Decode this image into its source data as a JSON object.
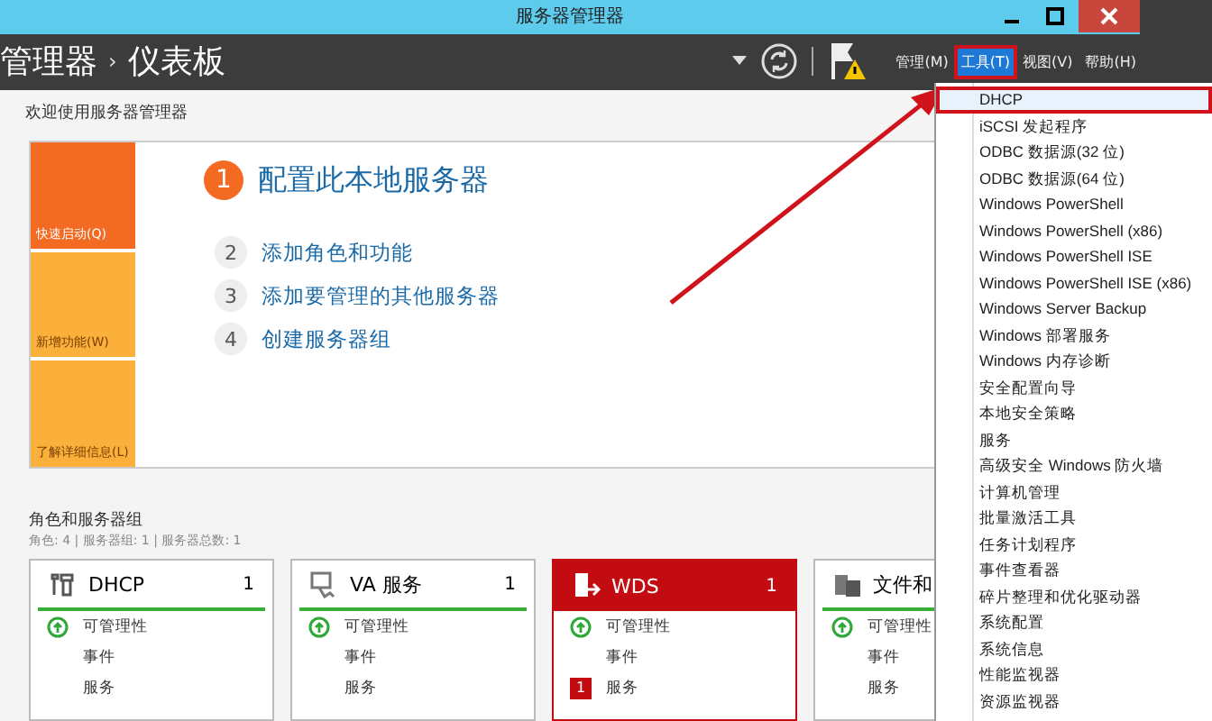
{
  "window": {
    "title": "服务器管理器"
  },
  "breadcrumb": {
    "parent": "管理器",
    "separator": "›",
    "current": "仪表板"
  },
  "menubar": [
    {
      "label": "管理(M)",
      "selected": false,
      "highlighted": false
    },
    {
      "label": "工具(T)",
      "selected": true,
      "highlighted": true
    },
    {
      "label": "视图(V)",
      "selected": false,
      "highlighted": false
    },
    {
      "label": "帮助(H)",
      "selected": false,
      "highlighted": false
    }
  ],
  "welcome": {
    "title": "欢迎使用服务器管理器",
    "tiles": [
      {
        "label": "快速启动(Q)",
        "selected": true
      },
      {
        "label": "新增功能(W)",
        "selected": false
      },
      {
        "label": "了解详细信息(L)",
        "selected": false
      }
    ],
    "steps": [
      {
        "number": "1",
        "label": "配置此本地服务器",
        "primary": true
      },
      {
        "number": "2",
        "label": "添加角色和功能",
        "primary": false
      },
      {
        "number": "3",
        "label": "添加要管理的其他服务器",
        "primary": false
      },
      {
        "number": "4",
        "label": "创建服务器组",
        "primary": false
      }
    ]
  },
  "roles": {
    "title": "角色和服务器组",
    "summary": "角色: 4 | 服务器组: 1 | 服务器总数: 1",
    "cards": [
      {
        "name": "DHCP",
        "count": "1",
        "kind": "ok",
        "rows": [
          {
            "label": "可管理性",
            "kind": "ok"
          },
          {
            "label": "事件",
            "kind": "plain"
          },
          {
            "label": "服务",
            "kind": "plain"
          }
        ]
      },
      {
        "name": "VA 服务",
        "count": "1",
        "kind": "ok",
        "rows": [
          {
            "label": "可管理性",
            "kind": "ok"
          },
          {
            "label": "事件",
            "kind": "plain"
          },
          {
            "label": "服务",
            "kind": "plain"
          }
        ]
      },
      {
        "name": "WDS",
        "count": "1",
        "kind": "error",
        "rows": [
          {
            "label": "可管理性",
            "kind": "ok"
          },
          {
            "label": "事件",
            "kind": "plain"
          },
          {
            "label": "服务",
            "kind": "badge",
            "badge": "1"
          }
        ]
      },
      {
        "name": "文件和",
        "kind": "ok",
        "rows": [
          {
            "label": "可管理性",
            "kind": "ok"
          },
          {
            "label": "事件",
            "kind": "plain"
          },
          {
            "label": "服务",
            "kind": "plain"
          }
        ]
      }
    ]
  },
  "tools_menu": [
    {
      "label": "DHCP",
      "highlighted": true
    },
    {
      "label": "iSCSI 发起程序",
      "highlighted": false
    },
    {
      "label": "ODBC 数据源(32 位)",
      "highlighted": false
    },
    {
      "label": "ODBC 数据源(64 位)",
      "highlighted": false
    },
    {
      "label": "Windows PowerShell",
      "highlighted": false
    },
    {
      "label": "Windows PowerShell (x86)",
      "highlighted": false
    },
    {
      "label": "Windows PowerShell ISE",
      "highlighted": false
    },
    {
      "label": "Windows PowerShell ISE (x86)",
      "highlighted": false
    },
    {
      "label": "Windows Server Backup",
      "highlighted": false
    },
    {
      "label": "Windows 部署服务",
      "highlighted": false
    },
    {
      "label": "Windows 内存诊断",
      "highlighted": false
    },
    {
      "label": "安全配置向导",
      "highlighted": false
    },
    {
      "label": "本地安全策略",
      "highlighted": false
    },
    {
      "label": "服务",
      "highlighted": false
    },
    {
      "label": "高级安全 Windows 防火墙",
      "highlighted": false
    },
    {
      "label": "计算机管理",
      "highlighted": false
    },
    {
      "label": "批量激活工具",
      "highlighted": false
    },
    {
      "label": "任务计划程序",
      "highlighted": false
    },
    {
      "label": "事件查看器",
      "highlighted": false
    },
    {
      "label": "碎片整理和优化驱动器",
      "highlighted": false
    },
    {
      "label": "系统配置",
      "highlighted": false
    },
    {
      "label": "系统信息",
      "highlighted": false
    },
    {
      "label": "性能监视器",
      "highlighted": false
    },
    {
      "label": "资源监视器",
      "highlighted": false
    }
  ]
}
